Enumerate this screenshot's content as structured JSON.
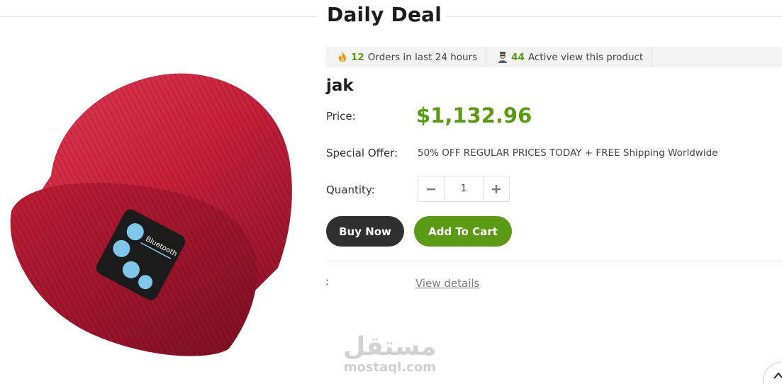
{
  "section": {
    "title": "Daily Deal"
  },
  "stats": {
    "orders": {
      "icon": "fire-icon",
      "count": "12",
      "text": "Orders in last 24 hours"
    },
    "viewers": {
      "icon": "visitor-icon",
      "count": "44",
      "text": "Active view this product"
    }
  },
  "product": {
    "name": "jak",
    "image_alt": "Red knitted beanie with Bluetooth controls",
    "image_text": "Bluetooth",
    "price_label": "Price:",
    "price": "$1,132.96",
    "offer_label": "Special Offer:",
    "offer_text": "50% OFF REGULAR PRICES TODAY + FREE Shipping Worldwide",
    "quantity_label": "Quantity:",
    "quantity": "1"
  },
  "actions": {
    "buy_now": "Buy Now",
    "add_to_cart": "Add To Cart"
  },
  "details": {
    "label": ":",
    "link": "View details"
  },
  "watermark": {
    "arabic": "مستقل",
    "latin": "mostaql.com"
  },
  "colors": {
    "accent_green": "#5b9a14",
    "dark_button": "#2f2f2f",
    "beanie_red": "#c8203a"
  },
  "icons": {
    "minus": "minus-icon",
    "plus": "plus-icon",
    "scroll_top": "chevron-up-icon"
  }
}
